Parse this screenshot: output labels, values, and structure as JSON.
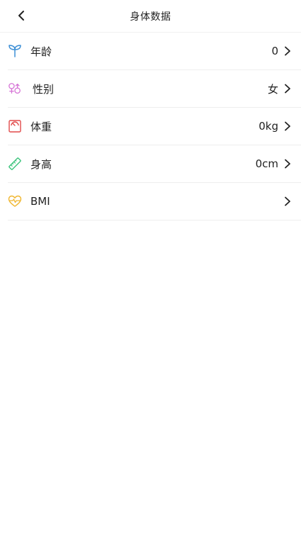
{
  "header": {
    "title": "身体数据"
  },
  "rows": [
    {
      "label": "年龄",
      "value": "0",
      "icon": "sprout-icon",
      "color": "#3d8fd6"
    },
    {
      "label": "性别",
      "value": "女",
      "icon": "gender-icon",
      "color": "#d672d6"
    },
    {
      "label": "体重",
      "value": "0kg",
      "icon": "scale-icon",
      "color": "#e24a4a"
    },
    {
      "label": "身高",
      "value": "0cm",
      "icon": "ruler-icon",
      "color": "#3cc47c"
    },
    {
      "label": "BMI",
      "value": "",
      "icon": "heartbeat-icon",
      "color": "#f0b731"
    }
  ]
}
